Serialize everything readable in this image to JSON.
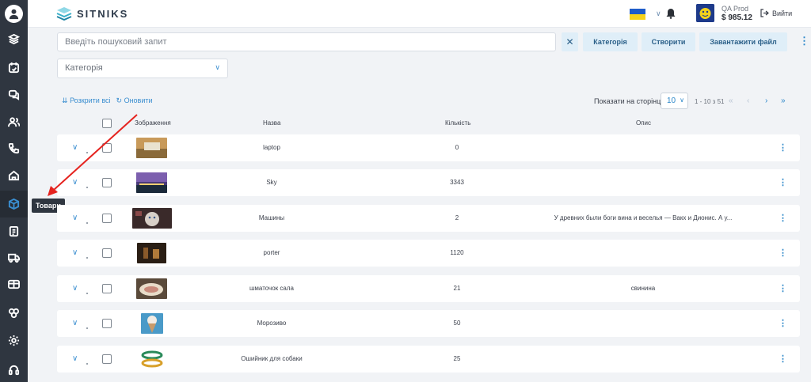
{
  "brand": {
    "name": "SITNIKS"
  },
  "account": {
    "name": "QA Prod",
    "balance": "$ 985.12",
    "logout": "Вийти"
  },
  "sidebar": {
    "tooltip": "Товари",
    "icons": [
      "layers-icon",
      "calendar-icon",
      "chat-icon",
      "users-icon",
      "phone-icon",
      "home-icon",
      "box-icon",
      "document-icon",
      "truck-icon",
      "wallet-icon",
      "integrations-icon",
      "settings-icon",
      "headset-icon"
    ]
  },
  "search": {
    "placeholder": "Введіть пошуковий запит"
  },
  "actions": {
    "category": "Категорія",
    "create": "Створити",
    "upload": "Завантажити файл"
  },
  "filter": {
    "category_placeholder": "Категорія"
  },
  "toolbar": {
    "expand_all": "Розкрити всі",
    "refresh": "Оновити"
  },
  "pagination": {
    "per_page_label": "Показати на сторінці",
    "per_page": "10",
    "range": "1 - 10 з 51"
  },
  "table": {
    "headers": {
      "image": "Зображення",
      "name": "Назва",
      "quantity": "Кількість",
      "description": "Опис"
    },
    "rows": [
      {
        "name": "laptop",
        "quantity": "0",
        "description": ""
      },
      {
        "name": "Sky",
        "quantity": "3343",
        "description": ""
      },
      {
        "name": "Машины",
        "quantity": "2",
        "description": "У древних были боги вина и веселья — Вакх и Дионис. А у..."
      },
      {
        "name": "porter",
        "quantity": "1120",
        "description": ""
      },
      {
        "name": "шматочок сала",
        "quantity": "21",
        "description": "свинина"
      },
      {
        "name": "Морозиво",
        "quantity": "50",
        "description": ""
      },
      {
        "name": "Ошийник для собаки",
        "quantity": "25",
        "description": ""
      }
    ]
  },
  "colors": {
    "sidebar": "#2f3640",
    "accent": "#2a86c9",
    "button_bg": "#dfeef8",
    "annotation_arrow": "#e5231f"
  }
}
